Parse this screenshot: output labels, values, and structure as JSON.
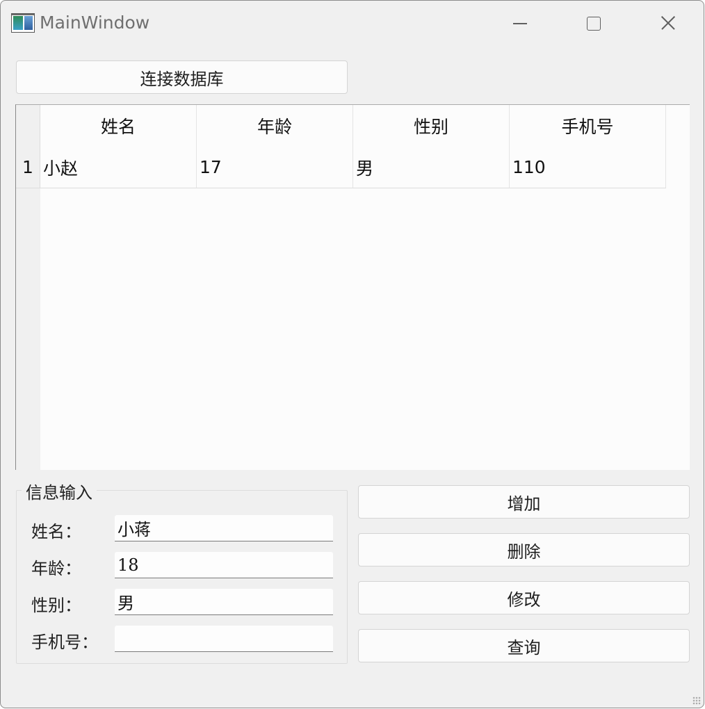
{
  "window": {
    "title": "MainWindow"
  },
  "toolbar": {
    "connect_label": "连接数据库"
  },
  "table": {
    "headers": [
      "姓名",
      "年龄",
      "性别",
      "手机号"
    ],
    "rows": [
      {
        "index": "1",
        "cells": [
          "小赵",
          "17",
          "男",
          "110"
        ]
      }
    ]
  },
  "form": {
    "title": "信息输入",
    "fields": [
      {
        "label": "姓名：",
        "value": "小蒋"
      },
      {
        "label": "年龄：",
        "value": "18"
      },
      {
        "label": "性别：",
        "value": "男"
      },
      {
        "label": "手机号：",
        "value": ""
      }
    ]
  },
  "actions": {
    "add": "增加",
    "delete": "删除",
    "modify": "修改",
    "query": "查询"
  }
}
